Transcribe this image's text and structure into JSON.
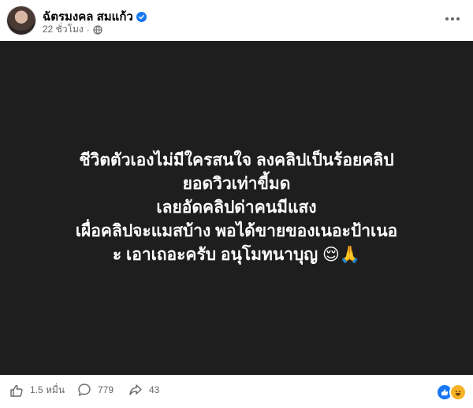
{
  "post": {
    "author": "ฉัตรมงคล สมแก้ว",
    "verified": true,
    "time": "22 ชั่วโมง",
    "privacy_icon": "globe-icon",
    "more_icon": "more-horizontal-icon"
  },
  "image_text": {
    "lines": [
      "ชีวิตตัวเองไม่มีใครสนใจ ลงคลิปเป็นร้อยคลิป",
      "ยอดวิวเท่าขี้มด",
      "เลยอัดคลิปด่าคนมีแสง",
      "เผื่อคลิปจะแมสบ้าง พอได้ขายของเนอะป้าเนอ",
      "ะ เอาเถอะครับ อนุโมทนาบุญ 😌🙏"
    ],
    "background_color": "#1e1e1f",
    "text_color": "#ffffff"
  },
  "footer": {
    "likes": "1.5 หมื่น",
    "comments": "779",
    "shares": "43",
    "reactions": [
      "like",
      "haha"
    ]
  }
}
